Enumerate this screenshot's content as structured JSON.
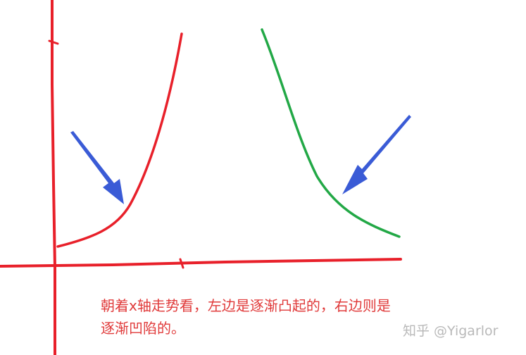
{
  "caption": {
    "line1": "朝着x轴走势看，左边是逐渐凸起的，右边则是",
    "line2": "逐渐凹陷的。"
  },
  "watermark": "知乎 @Yigarlor",
  "colors": {
    "axis": "#e8202a",
    "left_curve": "#e8202a",
    "right_curve": "#22a846",
    "arrow": "#3a5bd6",
    "caption_text": "#e03a3a",
    "watermark_text": "#b9b9b9"
  }
}
